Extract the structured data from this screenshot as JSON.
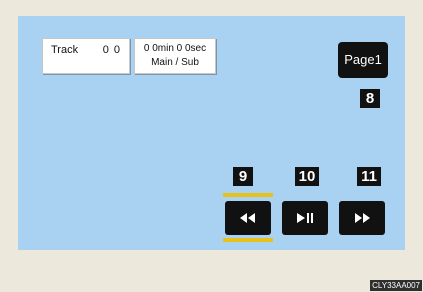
{
  "info": {
    "track_label": "Track",
    "track_value": "0 0",
    "time_line1": "0 0min 0 0sec",
    "time_line2": "Main / Sub"
  },
  "page_button": {
    "label": "Page1"
  },
  "callouts": {
    "page": "8",
    "rewind": "9",
    "play_pause": "10",
    "fast_forward": "11"
  },
  "controls": {
    "rewind_icon": "rewind-icon",
    "play_pause_icon": "play-pause-icon",
    "fast_forward_icon": "fast-forward-icon",
    "selected": "rewind"
  },
  "colors": {
    "screen_background": "#a9d2f2",
    "selection_highlight": "#e7c21d"
  },
  "figure_code": "CLY33AA007"
}
